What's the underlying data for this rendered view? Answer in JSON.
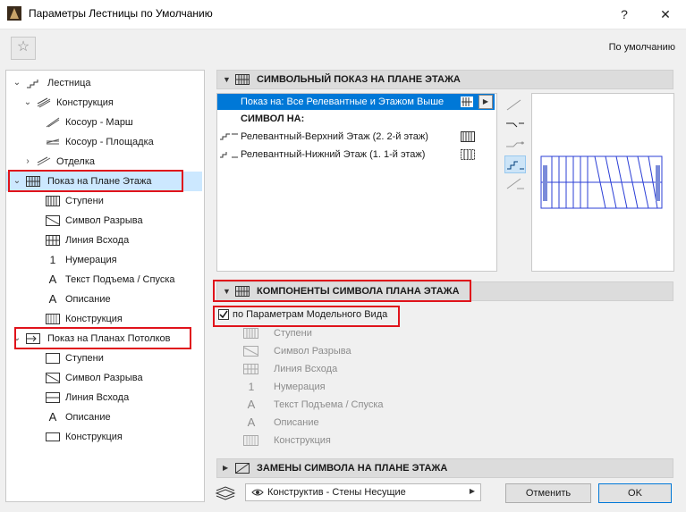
{
  "window": {
    "title": "Параметры Лестницы по Умолчанию",
    "help": "?",
    "close": "✕"
  },
  "toolbar": {
    "star": "☆",
    "default_label": "По умолчанию"
  },
  "tree": [
    {
      "label": "Лестница",
      "icon": "stair-icon"
    },
    {
      "label": "Конструкция",
      "icon": "structure-icon"
    },
    {
      "label": "Косоур - Марш",
      "icon": "stringer-flight-icon"
    },
    {
      "label": "Косоур - Площадка",
      "icon": "stringer-landing-icon"
    },
    {
      "label": "Отделка",
      "icon": "finish-icon"
    },
    {
      "label": "Показ на Плане Этажа",
      "icon": "floor-plan-icon"
    },
    {
      "label": "Ступени",
      "icon": "treads-icon"
    },
    {
      "label": "Символ Разрыва",
      "icon": "break-mark-icon"
    },
    {
      "label": "Линия Всхода",
      "icon": "walking-line-icon"
    },
    {
      "label": "Нумерация",
      "icon": "numbering-icon"
    },
    {
      "label": "Текст Подъема / Спуска",
      "icon": "up-down-text-icon"
    },
    {
      "label": "Описание",
      "icon": "description-icon"
    },
    {
      "label": "Конструкция",
      "icon": "structure-plan-icon"
    },
    {
      "label": "Показ на Планах Потолков",
      "icon": "ceiling-plan-icon"
    },
    {
      "label": "Ступени",
      "icon": "rcp-treads-icon"
    },
    {
      "label": "Символ Разрыва",
      "icon": "rcp-break-mark-icon"
    },
    {
      "label": "Линия Всхода",
      "icon": "rcp-walking-line-icon"
    },
    {
      "label": "Описание",
      "icon": "rcp-description-icon"
    },
    {
      "label": "Конструкция",
      "icon": "rcp-structure-icon"
    }
  ],
  "symbol_panel": {
    "header": "СИМВОЛЬНЫЙ ПОКАЗ НА ПЛАНЕ ЭТАЖА",
    "show_on": "Показ на: Все Релевантные и Этажом Выше",
    "symbol_on": "СИМВОЛ НА:",
    "rows": [
      {
        "label": "Релевантный-Верхний Этаж (2. 2-й этаж)"
      },
      {
        "label": "Релевантный-Нижний Этаж (1. 1-й этаж)"
      }
    ]
  },
  "components_panel": {
    "header": "КОМПОНЕНТЫ СИМВОЛА ПЛАНА ЭТАЖА",
    "checkbox_label": "по Параметрам Модельного Вида",
    "checked": true,
    "items": [
      {
        "label": "Ступени",
        "icon": "treads-icon"
      },
      {
        "label": "Символ Разрыва",
        "icon": "break-mark-icon"
      },
      {
        "label": "Линия Всхода",
        "icon": "walking-line-icon"
      },
      {
        "label": "Нумерация",
        "icon": "numbering-icon"
      },
      {
        "label": "Текст Подъема / Спуска",
        "icon": "up-down-text-icon"
      },
      {
        "label": "Описание",
        "icon": "description-icon"
      },
      {
        "label": "Конструкция",
        "icon": "structure-icon"
      }
    ]
  },
  "override_panel": {
    "header": "ЗАМЕНЫ СИМВОЛА НА ПЛАНЕ ЭТАЖА"
  },
  "footer": {
    "view_combo": "Конструктив - Стены Несущие",
    "cancel": "Отменить",
    "ok": "OK"
  },
  "colors": {
    "accent": "#0078d7",
    "highlight_box": "#e0131b",
    "selected_row": "#cce8ff"
  }
}
